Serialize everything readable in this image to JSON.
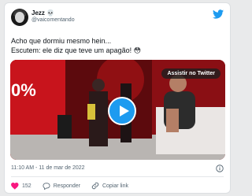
{
  "tweet": {
    "author_name": "Jezz",
    "author_emoji": "💀",
    "handle": "@vaicomentando",
    "lines": [
      "Acho que dormiu mesmo hein...",
      "Escutem: ele diz que teve um apagão! 😳"
    ],
    "timestamp": "11:10 AM - 11 de mar de 2022"
  },
  "video": {
    "watch_label": "Assistir no Twitter",
    "overlay_text": "0%"
  },
  "actions": {
    "like_count": "152",
    "reply_label": "Responder",
    "copy_label": "Copiar link"
  },
  "colors": {
    "accent": "#1d9bf0",
    "like": "#f91880",
    "muted": "#536471"
  }
}
